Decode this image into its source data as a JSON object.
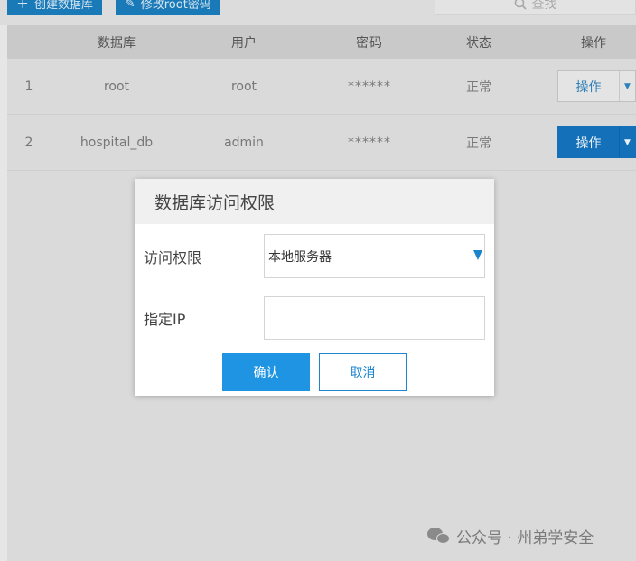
{
  "toolbar": {
    "create_db_label": "创建数据库",
    "change_root_pwd_label": "修改root密码",
    "search_label": "查找"
  },
  "table": {
    "headers": [
      "数据库",
      "用户",
      "密码",
      "状态",
      "操作"
    ],
    "rows": [
      {
        "index": "1",
        "database": "root",
        "user": "root",
        "password": "******",
        "status": "正常",
        "action": "操作"
      },
      {
        "index": "2",
        "database": "hospital_db",
        "user": "admin",
        "password": "******",
        "status": "正常",
        "action": "操作"
      }
    ]
  },
  "modal": {
    "title": "数据库访问权限",
    "access_label": "访问权限",
    "access_value": "本地服务器",
    "ip_label": "指定IP",
    "ip_value": "",
    "confirm_label": "确认",
    "cancel_label": "取消"
  },
  "watermark": {
    "text": "公众号 · 州弟学安全"
  },
  "colors": {
    "primary": "#1e94e2",
    "row_action_primary": "#1470b8",
    "overlay_gray": "#dadada"
  },
  "icons": [
    "plus-icon",
    "pencil-icon",
    "search-icon",
    "caret-down-icon",
    "wechat-icon"
  ]
}
